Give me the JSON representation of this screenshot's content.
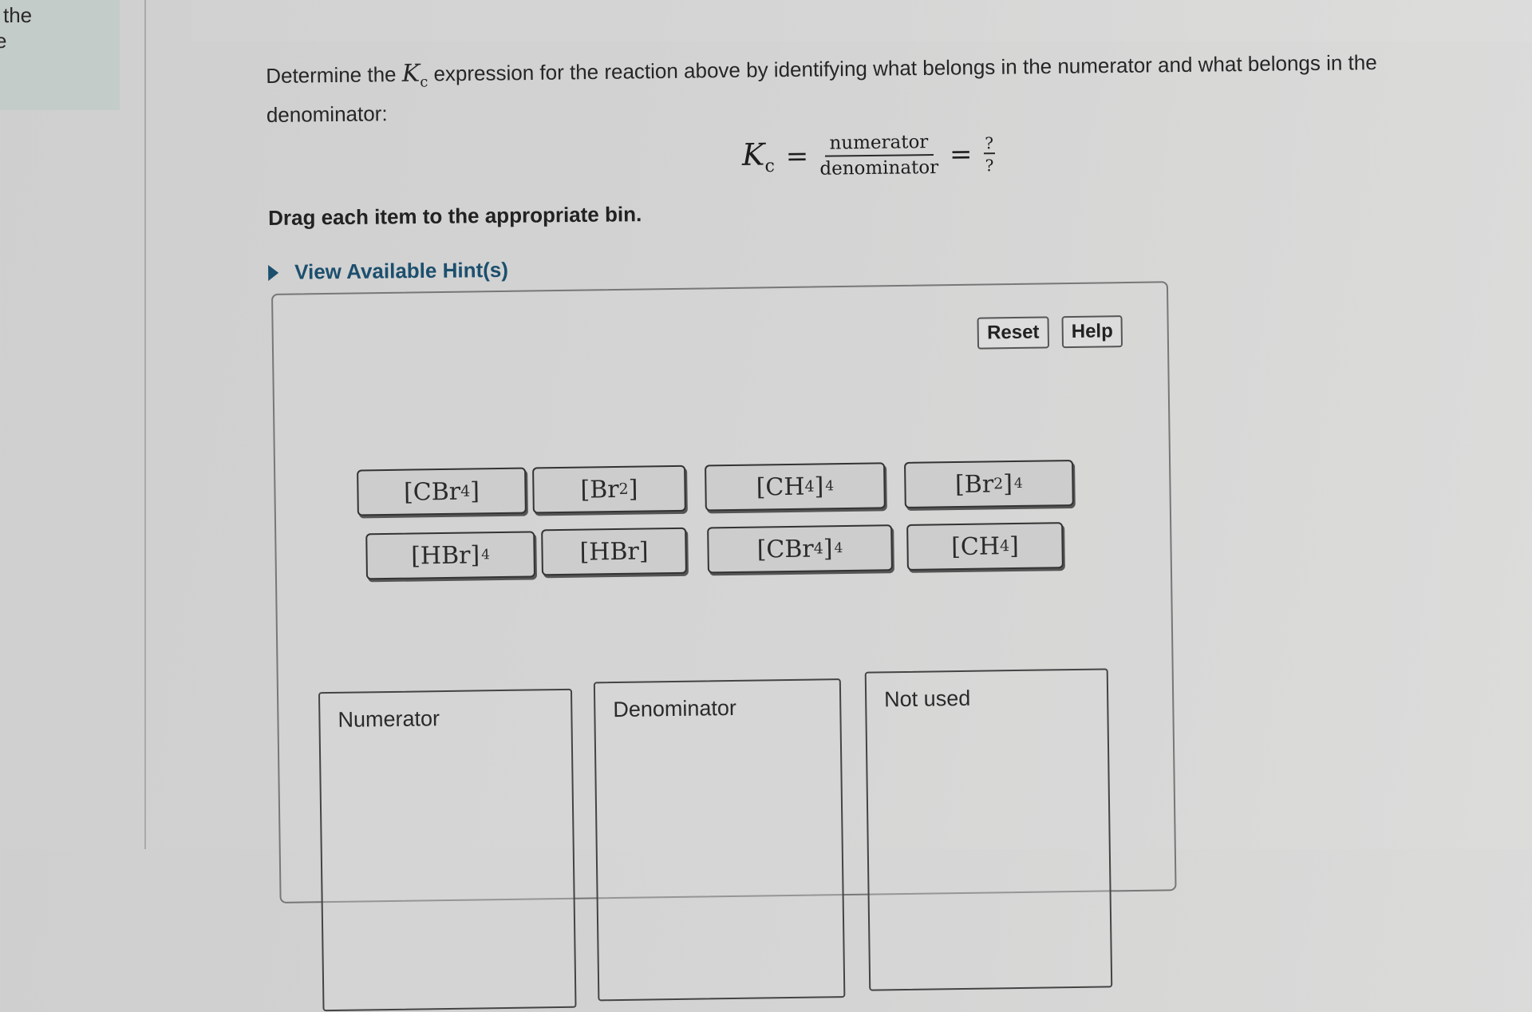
{
  "sidebar": {
    "text_line1": "the",
    "text_line2": "e"
  },
  "question": {
    "prefix": "Determine the ",
    "k_symbol": "K",
    "k_subscript": "c",
    "suffix": " expression for the reaction above by identifying what belongs in the numerator and what belongs in the denominator:"
  },
  "formula": {
    "k_symbol": "K",
    "k_subscript": "c",
    "equals": "=",
    "numerator": "numerator",
    "denominator": "denominator",
    "result_numerator": "?",
    "result_denominator": "?"
  },
  "instruction": "Drag each item to the appropriate bin.",
  "hint_link": "View Available Hint(s)",
  "toolbar": {
    "reset_label": "Reset",
    "help_label": "Help"
  },
  "tokens": [
    {
      "species": "CBr",
      "subscript": "4",
      "power": ""
    },
    {
      "species": "Br",
      "subscript": "2",
      "power": ""
    },
    {
      "species": "CH",
      "subscript": "4",
      "power": "4"
    },
    {
      "species": "Br",
      "subscript": "2",
      "power": "4"
    },
    {
      "species": "HBr",
      "subscript": "",
      "power": "4"
    },
    {
      "species": "HBr",
      "subscript": "",
      "power": ""
    },
    {
      "species": "CBr",
      "subscript": "4",
      "power": "4"
    },
    {
      "species": "CH",
      "subscript": "4",
      "power": ""
    }
  ],
  "bins": [
    {
      "label": "Numerator"
    },
    {
      "label": "Denominator"
    },
    {
      "label": "Not used"
    }
  ]
}
